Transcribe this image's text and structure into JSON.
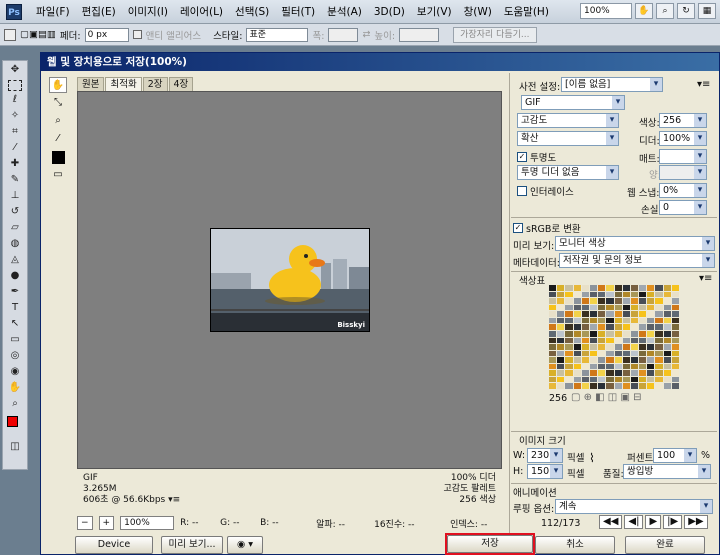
{
  "menubar": {
    "logo": "Ps",
    "items": [
      "파일(F)",
      "편집(E)",
      "이미지(I)",
      "레이어(L)",
      "선택(S)",
      "필터(T)",
      "분석(A)",
      "3D(D)",
      "보기(V)",
      "창(W)",
      "도움말(H)"
    ],
    "zoom": "100%"
  },
  "options": {
    "feather_label": "페더:",
    "feather_value": "0 px",
    "antialias_label": "앤티 앨리어스",
    "style_label": "스타일:",
    "style_value": "표준",
    "width_label": "폭:",
    "height_label": "높이:",
    "refine_button": "가장자리 다듬기..."
  },
  "dialog": {
    "title": "웹 및 장치용으로 저장(100%)",
    "tabs": [
      "원본",
      "최적화",
      "2장",
      "4장"
    ],
    "info_left": [
      "GIF",
      "3.265M",
      "606초 @ 56.6Kbps"
    ],
    "info_right": [
      "100% 디더",
      "고감도 팔레트",
      "256 색상"
    ],
    "status": {
      "zoom": "100%",
      "r": "R: --",
      "g": "G: --",
      "b": "B: --",
      "alpha": "알파: --",
      "hex": "16진수: --",
      "index": "인덱스: --"
    },
    "buttons": {
      "device_central": "Device Central...",
      "preview": "미리 보기...",
      "save": "저장",
      "cancel": "취소",
      "done": "완료"
    },
    "watermark": "Bisskyi"
  },
  "settings": {
    "preset_label": "사전 설정:",
    "preset_value": "[이름 없음]",
    "format": "GIF",
    "reduction": "고감도",
    "colors_label": "색상:",
    "colors_value": "256",
    "dither_algo": "확산",
    "dither_label": "디더:",
    "dither_value": "100%",
    "transparency": "투명도",
    "matte_label": "매트:",
    "trans_dither": "투명 디더 없음",
    "amount_label": "양:",
    "interlace": "인터레이스",
    "websnap_label": "웹 스냅:",
    "websnap_value": "0%",
    "lossy_label": "손실:",
    "lossy_value": "0",
    "srgb": "sRGB로 변환",
    "preview_label": "미리 보기:",
    "preview_value": "모니터 색상",
    "metadata_label": "메타데이터:",
    "metadata_value": "저작권 및 문의 정보"
  },
  "color_table": {
    "title": "색상표",
    "count": "256"
  },
  "image_size": {
    "title": "이미지 크기",
    "w_label": "W:",
    "w_value": "230",
    "h_label": "H:",
    "h_value": "150",
    "unit": "픽셀",
    "percent_label": "퍼센트:",
    "percent_value": "100",
    "percent_sign": "%",
    "quality_label": "품질:",
    "quality_value": "쌍입방"
  },
  "animation": {
    "title": "애니메이션",
    "loop_label": "루핑 옵션:",
    "loop_value": "계속",
    "frame": "112/173"
  },
  "colors": {
    "accent": "#e01020",
    "title_bar": "#0a246a",
    "duck": "#f6c21c"
  }
}
